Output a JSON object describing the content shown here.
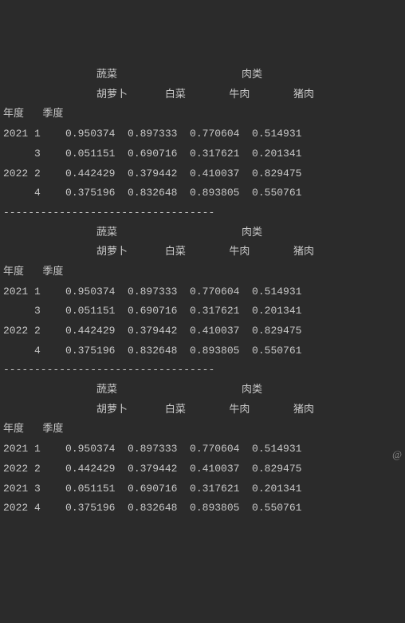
{
  "headers": {
    "cat1": "蔬菜",
    "cat2": "肉类",
    "sub1": "胡萝卜",
    "sub2": "白菜",
    "sub3": "牛肉",
    "sub4": "猪肉",
    "idx1": "年度",
    "idx2": "季度"
  },
  "sep": "----------------------------------",
  "tables": [
    {
      "rows": [
        {
          "y": "2021",
          "q": "1",
          "c1": "0.950374",
          "c2": "0.897333",
          "c3": "0.770604",
          "c4": "0.514931"
        },
        {
          "y": "",
          "q": "3",
          "c1": "0.051151",
          "c2": "0.690716",
          "c3": "0.317621",
          "c4": "0.201341"
        },
        {
          "y": "2022",
          "q": "2",
          "c1": "0.442429",
          "c2": "0.379442",
          "c3": "0.410037",
          "c4": "0.829475"
        },
        {
          "y": "",
          "q": "4",
          "c1": "0.375196",
          "c2": "0.832648",
          "c3": "0.893805",
          "c4": "0.550761"
        }
      ]
    },
    {
      "rows": [
        {
          "y": "2021",
          "q": "1",
          "c1": "0.950374",
          "c2": "0.897333",
          "c3": "0.770604",
          "c4": "0.514931"
        },
        {
          "y": "",
          "q": "3",
          "c1": "0.051151",
          "c2": "0.690716",
          "c3": "0.317621",
          "c4": "0.201341"
        },
        {
          "y": "2022",
          "q": "2",
          "c1": "0.442429",
          "c2": "0.379442",
          "c3": "0.410037",
          "c4": "0.829475"
        },
        {
          "y": "",
          "q": "4",
          "c1": "0.375196",
          "c2": "0.832648",
          "c3": "0.893805",
          "c4": "0.550761"
        }
      ]
    },
    {
      "rows": [
        {
          "y": "2021",
          "q": "1",
          "c1": "0.950374",
          "c2": "0.897333",
          "c3": "0.770604",
          "c4": "0.514931"
        },
        {
          "y": "2022",
          "q": "2",
          "c1": "0.442429",
          "c2": "0.379442",
          "c3": "0.410037",
          "c4": "0.829475"
        },
        {
          "y": "2021",
          "q": "3",
          "c1": "0.051151",
          "c2": "0.690716",
          "c3": "0.317621",
          "c4": "0.201341"
        },
        {
          "y": "2022",
          "q": "4",
          "c1": "0.375196",
          "c2": "0.832648",
          "c3": "0.893805",
          "c4": "0.550761"
        }
      ]
    }
  ],
  "atmark": "@"
}
